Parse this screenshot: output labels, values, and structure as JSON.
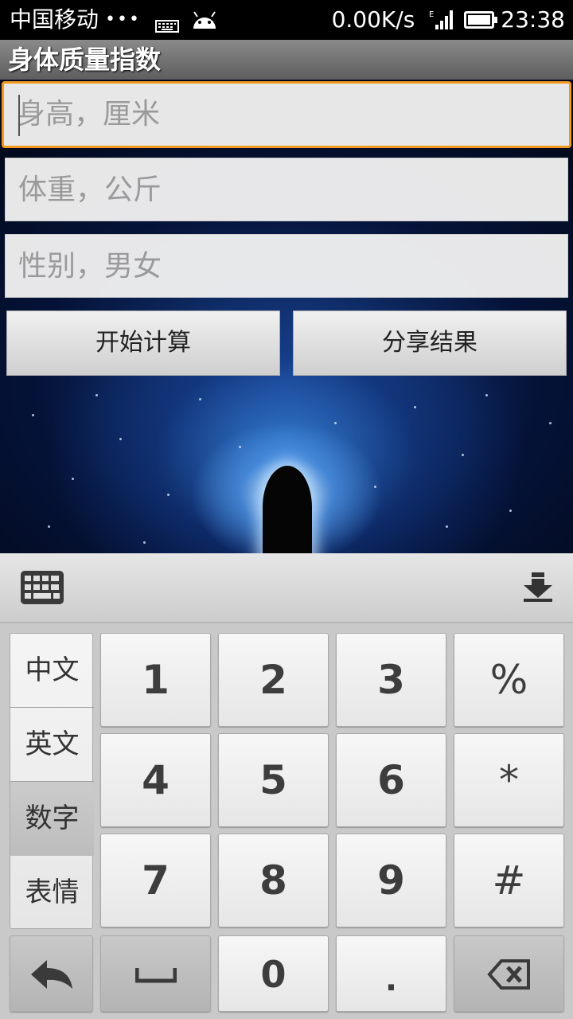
{
  "status_bar": {
    "carrier": "中国移动",
    "dots": "•••",
    "net_speed": "0.00K/s",
    "network_type": "E",
    "time": "23:38",
    "icons": [
      "keyboard-icon",
      "android-icon",
      "signal-icon",
      "battery-icon"
    ]
  },
  "app": {
    "title": "身体质量指数",
    "fields": [
      {
        "placeholder": "身高，厘米"
      },
      {
        "placeholder": "体重，公斤"
      },
      {
        "placeholder": "性别，男女"
      }
    ],
    "buttons": {
      "calculate": "开始计算",
      "share": "分享结果"
    }
  },
  "keyboard": {
    "modes": [
      "中文",
      "英文",
      "数字",
      "表情"
    ],
    "active_mode": "数字",
    "keys": {
      "row1": [
        "1",
        "2",
        "3",
        "%"
      ],
      "row2": [
        "4",
        "5",
        "6",
        "*"
      ],
      "row3": [
        "7",
        "8",
        "9",
        "#"
      ],
      "zero": "0",
      "dot": "."
    },
    "icons": [
      "keyboard-layout-icon",
      "hide-keyboard-icon",
      "back-arrow-icon",
      "space-icon",
      "backspace-icon"
    ]
  }
}
